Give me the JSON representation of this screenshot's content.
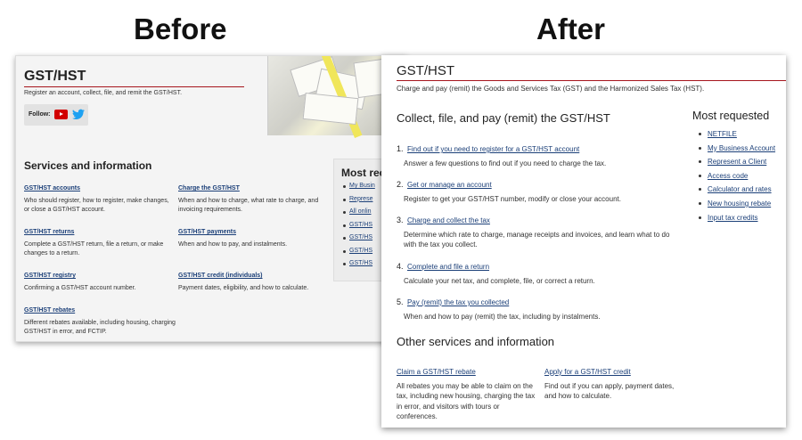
{
  "headings": {
    "before": "Before",
    "after": "After"
  },
  "before": {
    "title": "GST/HST",
    "subtitle": "Register an account, collect, file, and remit the GST/HST.",
    "follow_label": "Follow:",
    "services_heading": "Services and information",
    "services": [
      {
        "link": "GST/HST accounts",
        "desc": "Who should register, how to register, make changes, or close a GST/HST account."
      },
      {
        "link": "Charge the GST/HST",
        "desc": "When and how to charge, what rate to charge, and invoicing requirements."
      },
      {
        "link": "GST/HST returns",
        "desc": "Complete a GST/HST return, file a return, or make changes to a return."
      },
      {
        "link": "GST/HST payments",
        "desc": "When and how to pay, and instalments."
      },
      {
        "link": "GST/HST registry",
        "desc": "Confirming a GST/HST account number."
      },
      {
        "link": "GST/HST credit (individuals)",
        "desc": "Payment dates, eligibility, and how to calculate."
      },
      {
        "link": "GST/HST rebates",
        "desc": "Different rebates available, including housing, charging GST/HST in error, and FCTIP."
      }
    ],
    "most_requested_heading": "Most rec",
    "most_requested": [
      "My Busin",
      "Represe",
      "All onlin",
      "GST/HS",
      "GST/HS",
      "GST/HS",
      "GST/HS"
    ]
  },
  "after": {
    "title": "GST/HST",
    "subtitle": "Charge and pay (remit) the Goods and Services Tax (GST) and the Harmonized Sales Tax (HST).",
    "main_heading": "Collect, file, and pay (remit) the GST/HST",
    "steps": [
      {
        "num": "1.",
        "link": "Find out if you need to register for a GST/HST account",
        "desc": "Answer a few questions to find out if you need to charge the tax."
      },
      {
        "num": "2.",
        "link": "Get or manage an account",
        "desc": "Register to get your GST/HST number, modify or close your account."
      },
      {
        "num": "3.",
        "link": "Charge and collect the tax",
        "desc": "Determine which rate to charge, manage receipts and invoices, and learn what to do with the tax you collect."
      },
      {
        "num": "4.",
        "link": "Complete and file a return",
        "desc": "Calculate your net tax, and complete, file, or correct a return."
      },
      {
        "num": "5.",
        "link": "Pay (remit) the tax you collected",
        "desc": "When and how to pay (remit) the tax, including by instalments."
      }
    ],
    "most_requested_heading": "Most requested",
    "most_requested": [
      "NETFILE",
      "My Business Account",
      "Represent a Client",
      "Access code",
      "Calculator and rates",
      "New housing rebate",
      "Input tax credits"
    ],
    "other_heading": "Other services and information",
    "other": [
      {
        "link": "Claim a GST/HST rebate",
        "desc": "All rebates you may be able to claim on the tax, including new housing, charging the tax in error, and visitors with tours or conferences."
      },
      {
        "link": "Apply for a GST/HST credit",
        "desc": "Find out if you can apply, payment dates, and how to calculate."
      }
    ]
  },
  "colors": {
    "accent_rule": "#a6151d",
    "link": "#1b3f78",
    "youtube": "#d20000",
    "twitter": "#1da1f2"
  }
}
